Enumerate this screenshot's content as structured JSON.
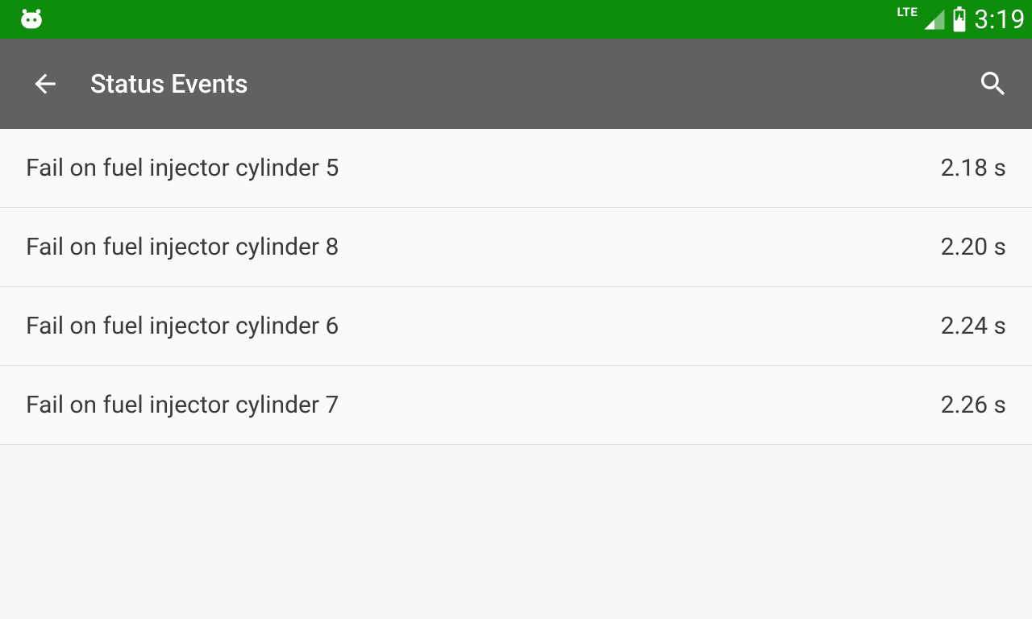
{
  "status_bar": {
    "network_label": "LTE",
    "time": "3:19"
  },
  "app_bar": {
    "title": "Status Events"
  },
  "events": [
    {
      "label": "Fail on fuel injector cylinder 5",
      "value": "2.18 s"
    },
    {
      "label": "Fail on fuel injector cylinder 8",
      "value": "2.20 s"
    },
    {
      "label": "Fail on fuel injector cylinder 6",
      "value": "2.24 s"
    },
    {
      "label": "Fail on fuel injector cylinder 7",
      "value": "2.26 s"
    }
  ]
}
